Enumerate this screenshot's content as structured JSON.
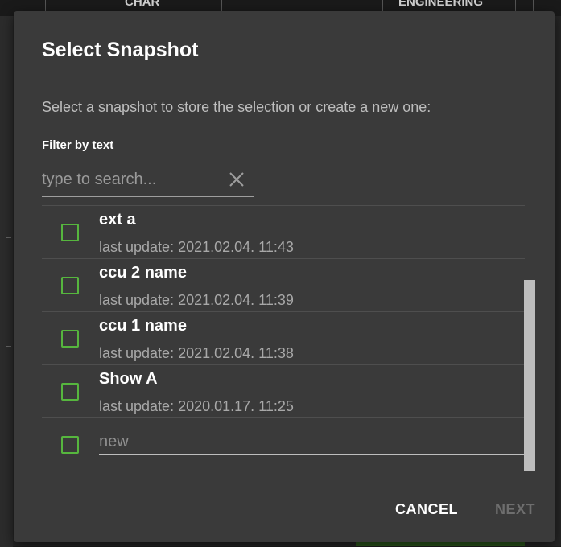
{
  "background": {
    "header_cells": [
      "CHAR",
      "ENGINEERING"
    ]
  },
  "dialog": {
    "title": "Select Snapshot",
    "description": "Select a snapshot to store the selection or create a new one:",
    "filter": {
      "label": "Filter by text",
      "placeholder": "type to search...",
      "value": ""
    },
    "snapshots": [
      {
        "name": "ext a",
        "last_update": "last update: 2021.02.04. 11:43"
      },
      {
        "name": "ccu 2 name",
        "last_update": "last update: 2021.02.04. 11:39"
      },
      {
        "name": "ccu 1 name",
        "last_update": "last update: 2021.02.04. 11:38"
      },
      {
        "name": "Show A",
        "last_update": "last update: 2020.01.17. 11:25"
      }
    ],
    "new_item": {
      "placeholder": "new"
    },
    "buttons": {
      "cancel": "CANCEL",
      "next": "NEXT"
    }
  },
  "colors": {
    "dialog_bg": "#3a3a3a",
    "checkbox_border": "#56b63e",
    "disabled_text": "#6e6e6e"
  }
}
